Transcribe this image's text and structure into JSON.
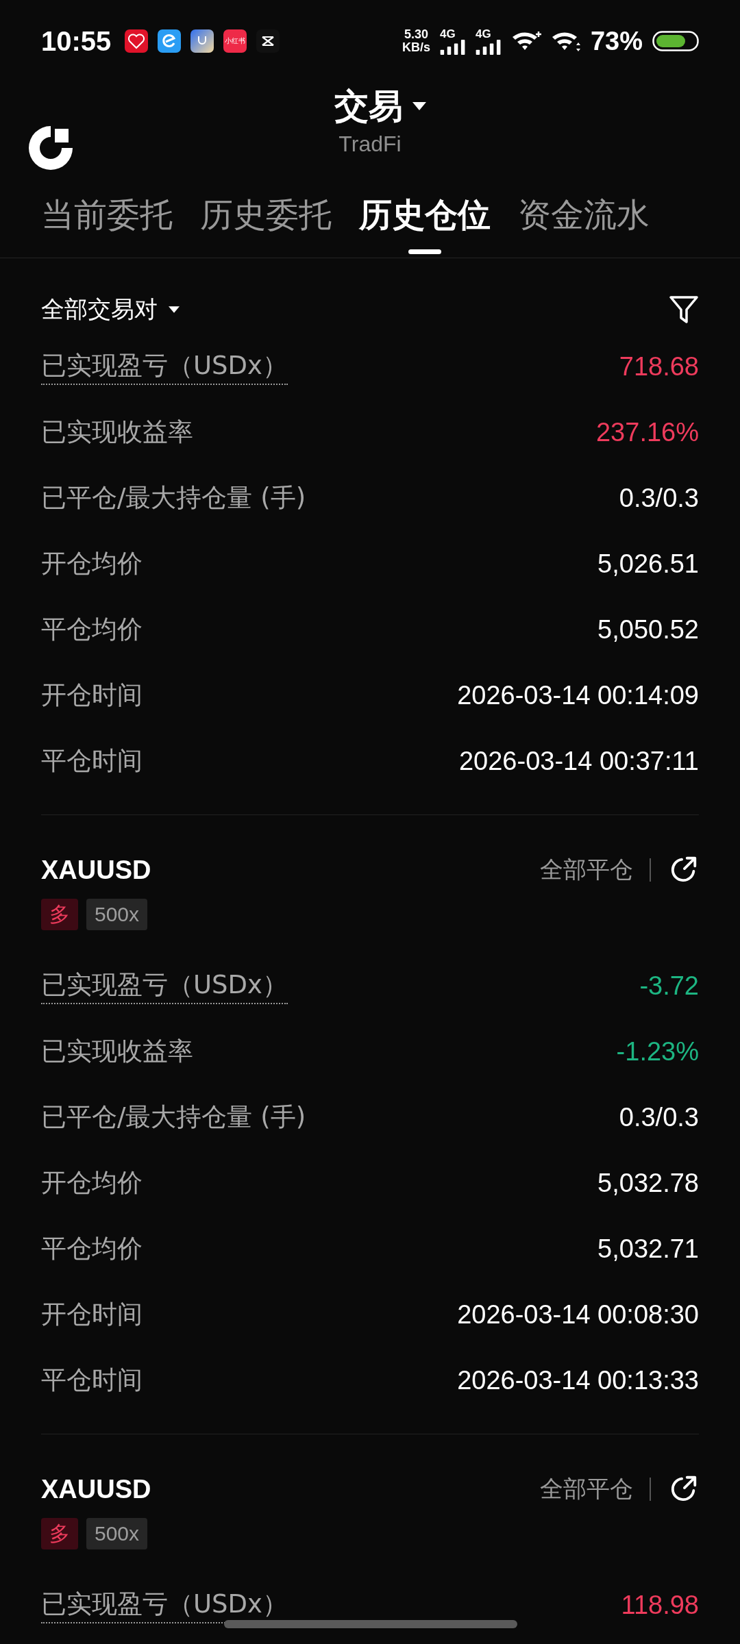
{
  "status_bar": {
    "time": "10:55",
    "apps": [
      {
        "kind": "heart"
      },
      {
        "kind": "e"
      },
      {
        "kind": "bag"
      },
      {
        "kind": "badge",
        "label": "小红书"
      },
      {
        "kind": "cut"
      }
    ],
    "speed": "5.30",
    "speed_unit": "KB/s",
    "networks": [
      "4G",
      "4G"
    ],
    "battery_text": "73%"
  },
  "header": {
    "title": "交易",
    "expanded": false,
    "subtitle": "TradFi"
  },
  "tabs": [
    {
      "label": "当前委托",
      "selected": false
    },
    {
      "label": "历史委托",
      "selected": false
    },
    {
      "label": "历史仓位",
      "selected": true
    },
    {
      "label": "资金流水",
      "selected": false
    }
  ],
  "filter": {
    "label": "全部交易对"
  },
  "sections": [
    {
      "rows": [
        {
          "label": "已实现盈亏（USDx）",
          "value": "718.68",
          "color": "#ee3b5c",
          "dotted": true
        },
        {
          "label": "已实现收益率",
          "value": "237.16%",
          "color": "#ee3b5c",
          "dotted": false
        },
        {
          "label": "已平仓/最大持仓量 (手)",
          "value": "0.3/0.3",
          "color": "#ffffff",
          "dotted": false
        },
        {
          "label": "开仓均价",
          "value": "5,026.51",
          "color": "#ffffff",
          "dotted": false
        },
        {
          "label": "平仓均价",
          "value": "5,050.52",
          "color": "#ffffff",
          "dotted": false
        },
        {
          "label": "开仓时间",
          "value": "2026-03-14 00:14:09",
          "color": "#ffffff",
          "dotted": false
        },
        {
          "label": "平仓时间",
          "value": "2026-03-14 00:37:11",
          "color": "#ffffff",
          "dotted": false
        }
      ]
    },
    {
      "symbol": "XAUUSD",
      "side": "多",
      "leverage": "500x",
      "action": "全部平仓",
      "rows": [
        {
          "label": "已实现盈亏（USDx）",
          "value": "-3.72",
          "color": "#1db582",
          "dotted": true
        },
        {
          "label": "已实现收益率",
          "value": "-1.23%",
          "color": "#1db582",
          "dotted": false
        },
        {
          "label": "已平仓/最大持仓量 (手)",
          "value": "0.3/0.3",
          "color": "#ffffff",
          "dotted": false
        },
        {
          "label": "开仓均价",
          "value": "5,032.78",
          "color": "#ffffff",
          "dotted": false
        },
        {
          "label": "平仓均价",
          "value": "5,032.71",
          "color": "#ffffff",
          "dotted": false
        },
        {
          "label": "开仓时间",
          "value": "2026-03-14 00:08:30",
          "color": "#ffffff",
          "dotted": false
        },
        {
          "label": "平仓时间",
          "value": "2026-03-14 00:13:33",
          "color": "#ffffff",
          "dotted": false
        }
      ]
    },
    {
      "symbol": "XAUUSD",
      "side": "多",
      "leverage": "500x",
      "action": "全部平仓",
      "rows": [
        {
          "label": "已实现盈亏（USDx）",
          "value": "118.98",
          "color": "#ee3b5c",
          "dotted": true
        }
      ]
    }
  ]
}
